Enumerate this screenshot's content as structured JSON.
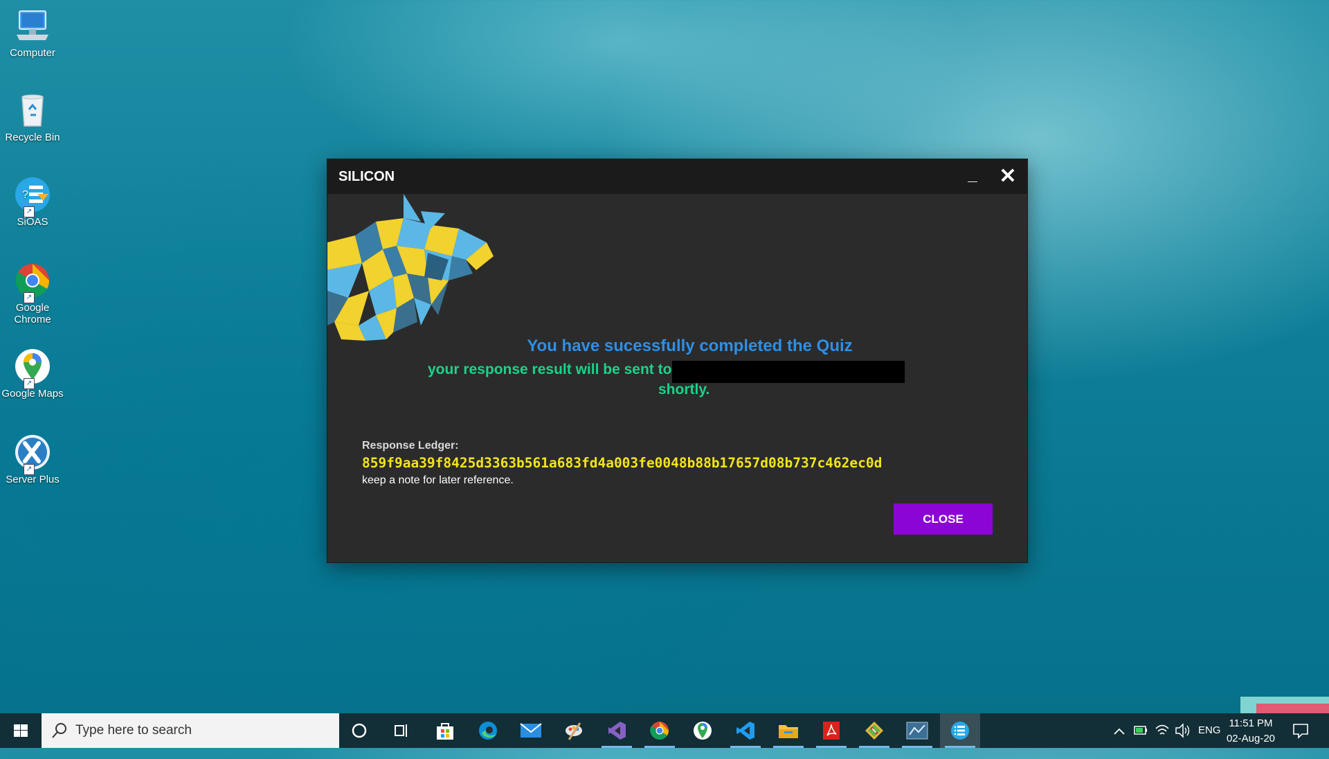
{
  "desktop": {
    "icons": [
      {
        "label": "Computer",
        "icon": "computer-icon"
      },
      {
        "label": "Recycle Bin",
        "icon": "recycle-bin-icon"
      },
      {
        "label": "SiOAS",
        "icon": "sioas-icon"
      },
      {
        "label": "Google Chrome",
        "icon": "chrome-icon"
      },
      {
        "label": "Google Maps",
        "icon": "maps-icon"
      },
      {
        "label": "Server Plus",
        "icon": "server-plus-icon"
      }
    ]
  },
  "window": {
    "title": "SILICON",
    "message_main": "You have sucessfully completed the Quiz",
    "message_sub": "your response result will be sent to",
    "message_end": "shortly.",
    "ledger_label": "Response Ledger:",
    "ledger_hash": "859f9aa39f8425d3363b561a683fd4a003fe0048b88b17657d08b737c462ec0d",
    "ledger_note": "keep a note for later reference.",
    "close_label": "CLOSE",
    "colors": {
      "title_bg": "#1b1b1b",
      "body_bg": "#2b2b2b",
      "main_msg": "#2e8fe6",
      "sub_msg": "#1bd38a",
      "hash": "#f3e51a",
      "button": "#8b06d6"
    }
  },
  "taskbar": {
    "search_placeholder": "Type here to search",
    "apps": [
      "cortana-icon",
      "task-view-icon",
      "store-icon",
      "edge-icon",
      "mail-icon",
      "paint-icon",
      "visual-studio-icon",
      "chrome-icon",
      "maps-icon",
      "vscode-icon",
      "file-explorer-icon",
      "acrobat-icon",
      "git-icon",
      "server-icon",
      "sioas-icon"
    ],
    "tray_lang": "ENG",
    "time": "11:51 PM",
    "date": "02-Aug-20"
  }
}
